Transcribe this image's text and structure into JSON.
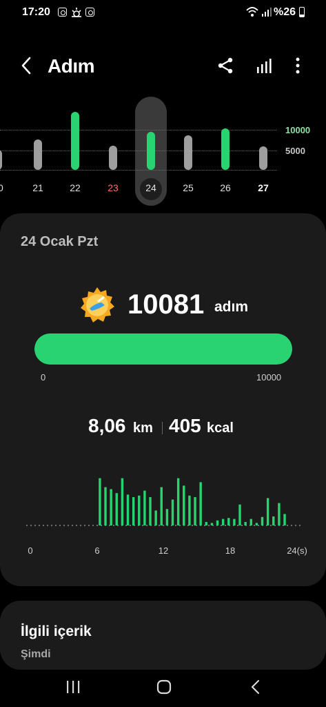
{
  "status_bar": {
    "time": "17:20",
    "battery": "%26",
    "icons": [
      "instagram-icon",
      "weather-icon",
      "instagram-icon",
      "wifi-icon",
      "signal-icon",
      "battery-icon"
    ]
  },
  "app_bar": {
    "title": "Adım",
    "icons": [
      "back-icon",
      "share-icon",
      "bar-chart-icon",
      "more-icon"
    ]
  },
  "day_strip": {
    "goal_label": "10000",
    "mid_label": "5000",
    "days": [
      {
        "label": "20",
        "level": 0.35,
        "goal_met": false,
        "sunday": false,
        "selected": false,
        "today": false
      },
      {
        "label": "21",
        "level": 0.52,
        "goal_met": false,
        "sunday": false,
        "selected": false,
        "today": false
      },
      {
        "label": "22",
        "level": 1.0,
        "goal_met": true,
        "sunday": false,
        "selected": false,
        "today": false
      },
      {
        "label": "23",
        "level": 0.42,
        "goal_met": false,
        "sunday": true,
        "selected": false,
        "today": false
      },
      {
        "label": "24",
        "level": 0.65,
        "goal_met": true,
        "sunday": false,
        "selected": true,
        "today": false
      },
      {
        "label": "25",
        "level": 0.6,
        "goal_met": false,
        "sunday": false,
        "selected": false,
        "today": false
      },
      {
        "label": "26",
        "level": 0.71,
        "goal_met": true,
        "sunday": false,
        "selected": false,
        "today": false
      },
      {
        "label": "27",
        "level": 0.4,
        "goal_met": false,
        "sunday": false,
        "selected": false,
        "today": true
      }
    ]
  },
  "summary": {
    "date": "24 Ocak Pzt",
    "steps": "10081",
    "steps_unit": "adım",
    "goal_progress": 1.0,
    "progress_min": "0",
    "progress_max": "10000",
    "distance": "8,06",
    "distance_unit": "km",
    "calories": "405",
    "calories_unit": "kcal",
    "badge_icon": "goal-badge-icon"
  },
  "chart_data": {
    "type": "bar",
    "x_ticks": [
      "0",
      "6",
      "12",
      "18",
      "24(s)"
    ],
    "xlim": [
      0,
      24
    ],
    "bar_color": "#2ad371",
    "values": [
      0,
      0,
      0,
      0,
      0,
      0,
      0,
      0,
      0,
      0,
      0,
      0,
      0.95,
      0.77,
      0.73,
      0.65,
      0.95,
      0.62,
      0.57,
      0.6,
      0.7,
      0.57,
      0.3,
      0.77,
      0.33,
      0.52,
      0.95,
      0.8,
      0.6,
      0.57,
      0.87,
      0.07,
      0.05,
      0.1,
      0.13,
      0.15,
      0.13,
      0.42,
      0.07,
      0.13,
      0.05,
      0.17,
      0.55,
      0.18,
      0.45,
      0.23,
      0.0,
      0.0
    ]
  },
  "related": {
    "title": "İlgili içerik",
    "subtitle": "Şimdi"
  },
  "nav_bar": {
    "icons": [
      "recents-icon",
      "home-icon",
      "nav-back-icon"
    ]
  },
  "colors": {
    "accent": "#2ad371",
    "goal_bar": "#2ad371",
    "normal_bar": "#9e9e9e",
    "sunday": "#ff6b6b",
    "card": "#1b1b1b",
    "background": "#000000"
  }
}
